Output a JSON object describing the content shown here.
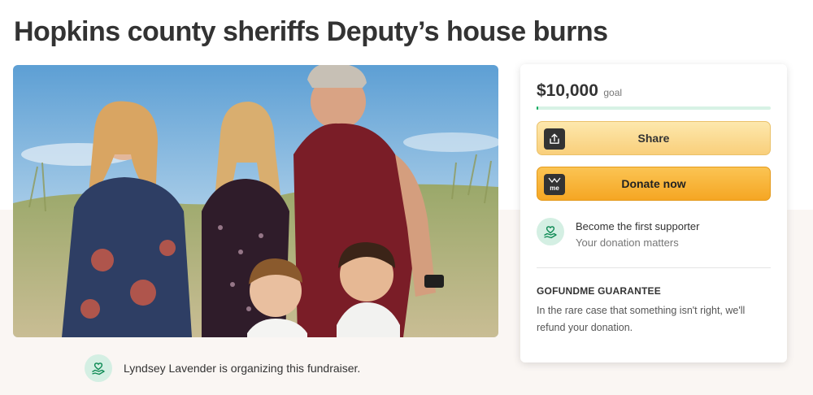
{
  "page": {
    "title": "Hopkins county sheriffs Deputy’s house burns"
  },
  "hero_image": {
    "alt": "Family photo of five people standing in beach grass under a blue sky"
  },
  "organizer": {
    "text": "Lyndsey Lavender is organizing this fundraiser."
  },
  "donation_card": {
    "goal_amount": "$10,000",
    "goal_label": "goal",
    "progress_fraction": 0.005,
    "share_label": "Share",
    "donate_label": "Donate now",
    "donate_icon_text": "me",
    "supporter_title": "Become the first supporter",
    "supporter_subtitle": "Your donation matters",
    "guarantee_title": "GOFUNDME GUARANTEE",
    "guarantee_text": "In the rare case that something isn't right, we'll refund your donation."
  },
  "colors": {
    "brand_green": "#02a95c",
    "donate_orange": "#f5a623",
    "share_yellow": "#f9cf7b"
  },
  "icons": [
    "upload-share-icon",
    "gofundme-me-icon",
    "heart-hand-icon"
  ]
}
